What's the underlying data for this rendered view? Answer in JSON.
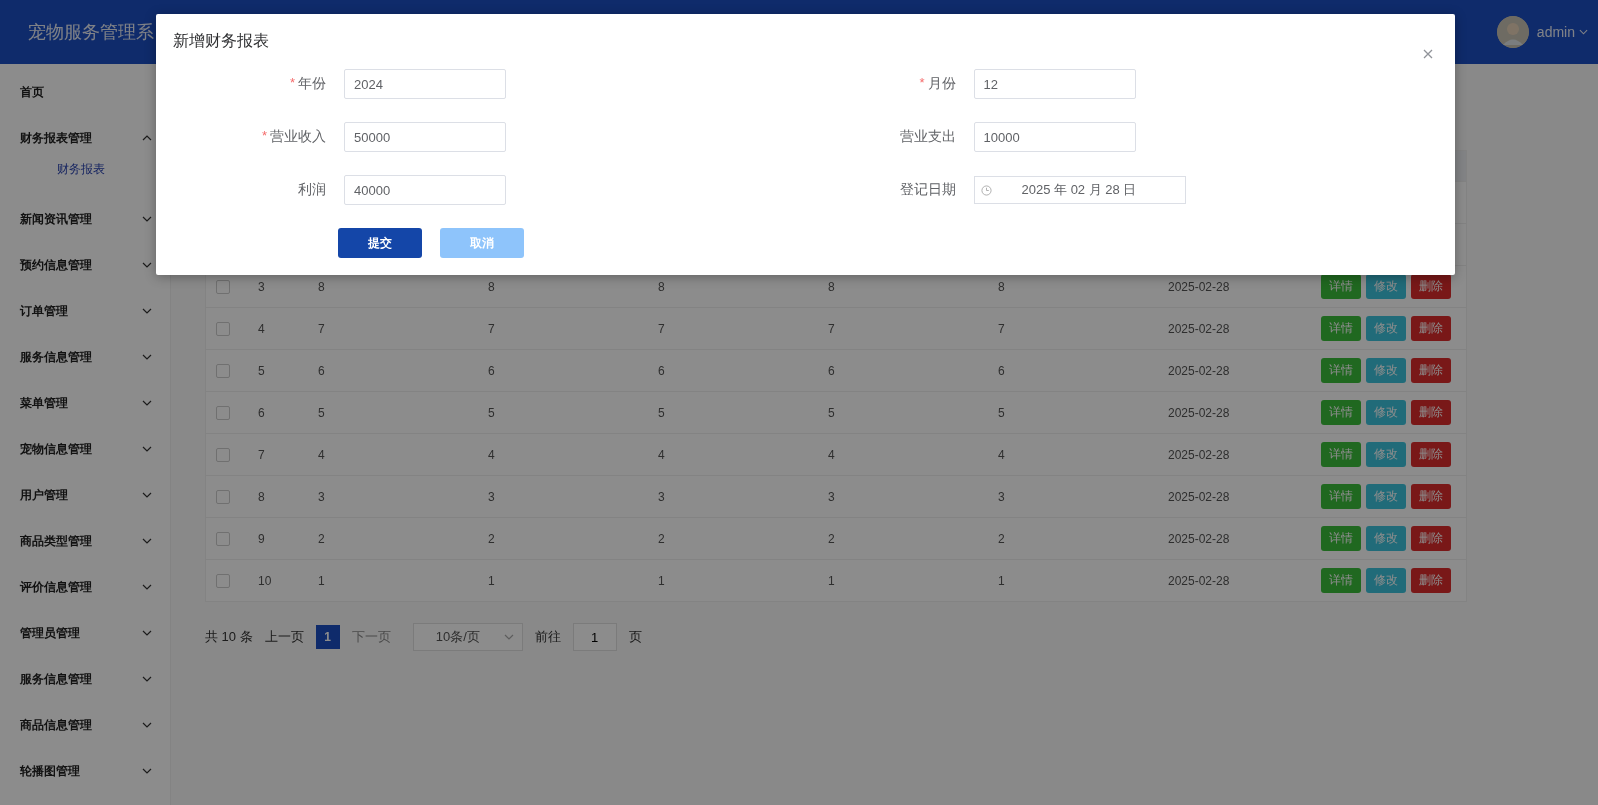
{
  "header": {
    "title": "宠物服务管理系",
    "user": "admin"
  },
  "sidebar": {
    "items": [
      {
        "label": "首页",
        "expandable": false
      },
      {
        "label": "财务报表管理",
        "expandable": true,
        "expanded": true,
        "children": [
          {
            "label": "财务报表",
            "selected": true
          }
        ]
      },
      {
        "label": "新闻资讯管理",
        "expandable": true,
        "expanded": false
      },
      {
        "label": "预约信息管理",
        "expandable": true,
        "expanded": false
      },
      {
        "label": "订单管理",
        "expandable": true,
        "expanded": false
      },
      {
        "label": "服务信息管理",
        "expandable": true,
        "expanded": false
      },
      {
        "label": "菜单管理",
        "expandable": true,
        "expanded": false
      },
      {
        "label": "宠物信息管理",
        "expandable": true,
        "expanded": false
      },
      {
        "label": "用户管理",
        "expandable": true,
        "expanded": false
      },
      {
        "label": "商品类型管理",
        "expandable": true,
        "expanded": false
      },
      {
        "label": "评价信息管理",
        "expandable": true,
        "expanded": false
      },
      {
        "label": "管理员管理",
        "expandable": true,
        "expanded": false
      },
      {
        "label": "服务信息管理",
        "expandable": true,
        "expanded": false
      },
      {
        "label": "商品信息管理",
        "expandable": true,
        "expanded": false
      },
      {
        "label": "轮播图管理",
        "expandable": true,
        "expanded": false
      }
    ]
  },
  "table": {
    "rows": [
      {
        "checked": false,
        "cells": [
          "3",
          "8",
          "8",
          "8",
          "8",
          "8",
          "2025-02-28"
        ],
        "actions": [
          {
            "kind": "detail",
            "label": "详情"
          },
          {
            "kind": "edit",
            "label": "修改"
          },
          {
            "kind": "delete",
            "label": "删除"
          }
        ]
      },
      {
        "checked": false,
        "cells": [
          "4",
          "7",
          "7",
          "7",
          "7",
          "7",
          "2025-02-28"
        ],
        "actions": [
          {
            "kind": "detail",
            "label": "详情"
          },
          {
            "kind": "edit",
            "label": "修改"
          },
          {
            "kind": "delete",
            "label": "删除"
          }
        ]
      },
      {
        "checked": false,
        "cells": [
          "5",
          "6",
          "6",
          "6",
          "6",
          "6",
          "2025-02-28"
        ],
        "actions": [
          {
            "kind": "detail",
            "label": "详情"
          },
          {
            "kind": "edit",
            "label": "修改"
          },
          {
            "kind": "delete",
            "label": "删除"
          }
        ]
      },
      {
        "checked": false,
        "cells": [
          "6",
          "5",
          "5",
          "5",
          "5",
          "5",
          "2025-02-28"
        ],
        "actions": [
          {
            "kind": "detail",
            "label": "详情"
          },
          {
            "kind": "edit",
            "label": "修改"
          },
          {
            "kind": "delete",
            "label": "删除"
          }
        ]
      },
      {
        "checked": false,
        "cells": [
          "7",
          "4",
          "4",
          "4",
          "4",
          "4",
          "2025-02-28"
        ],
        "actions": [
          {
            "kind": "detail",
            "label": "详情"
          },
          {
            "kind": "edit",
            "label": "修改"
          },
          {
            "kind": "delete",
            "label": "删除"
          }
        ]
      },
      {
        "checked": false,
        "cells": [
          "8",
          "3",
          "3",
          "3",
          "3",
          "3",
          "2025-02-28"
        ],
        "actions": [
          {
            "kind": "detail",
            "label": "详情"
          },
          {
            "kind": "edit",
            "label": "修改"
          },
          {
            "kind": "delete",
            "label": "删除"
          }
        ]
      },
      {
        "checked": false,
        "cells": [
          "9",
          "2",
          "2",
          "2",
          "2",
          "2",
          "2025-02-28"
        ],
        "actions": [
          {
            "kind": "detail",
            "label": "详情"
          },
          {
            "kind": "edit",
            "label": "修改"
          },
          {
            "kind": "delete",
            "label": "删除"
          }
        ]
      },
      {
        "checked": false,
        "cells": [
          "10",
          "1",
          "1",
          "1",
          "1",
          "1",
          "2025-02-28"
        ],
        "actions": [
          {
            "kind": "detail",
            "label": "详情"
          },
          {
            "kind": "edit",
            "label": "修改"
          },
          {
            "kind": "delete",
            "label": "删除"
          }
        ]
      }
    ]
  },
  "pagination": {
    "total": "共 10 条",
    "prev": "上一页",
    "pages": [
      {
        "label": "1",
        "selected": true
      }
    ],
    "next": "下一页",
    "next_disabled": true,
    "page_size": "10条/页",
    "goto": "前往",
    "goto_value": "1",
    "page_unit": "页"
  },
  "dialog": {
    "title": "新增财务报表",
    "required_mark": "*",
    "fields": [
      {
        "label": "年份",
        "required": true,
        "kind": "text",
        "value": "2024"
      },
      {
        "label": "月份",
        "required": true,
        "kind": "text",
        "value": "12"
      },
      {
        "label": "营业收入",
        "required": true,
        "kind": "text",
        "value": "50000"
      },
      {
        "label": "营业支出",
        "required": false,
        "kind": "text",
        "value": "10000"
      },
      {
        "label": "利润",
        "required": false,
        "kind": "text",
        "value": "40000"
      },
      {
        "label": "登记日期",
        "required": false,
        "kind": "date",
        "value": "2025 年 02 月 28 日"
      }
    ],
    "buttons": [
      {
        "kind": "primary",
        "label": "提交"
      },
      {
        "kind": "secondary",
        "label": "取消"
      }
    ]
  }
}
